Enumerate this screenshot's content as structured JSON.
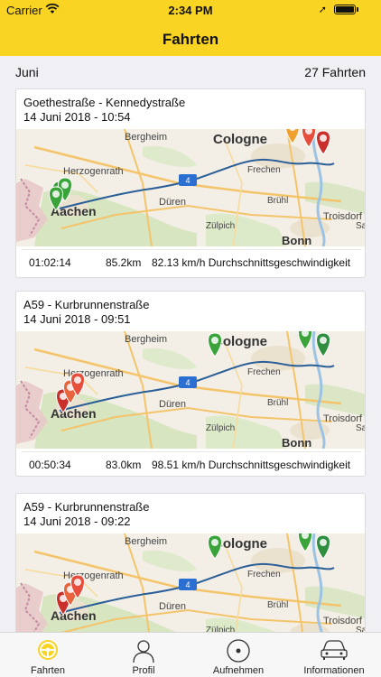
{
  "status_bar": {
    "carrier": "Carrier",
    "time": "2:34 PM"
  },
  "header": {
    "title": "Fahrten",
    "background": "#f9d423"
  },
  "subheader": {
    "month": "Juni",
    "count": "27 Fahrten"
  },
  "map_labels": {
    "bergheim": "Bergheim",
    "cologne": "Cologne",
    "herzogenrath": "Herzogenrath",
    "frechen": "Frechen",
    "dueren": "Düren",
    "aachen": "Aachen",
    "bruehl": "Brühl",
    "troisdorf": "Troisdorf",
    "zuelpich": "Zülpich",
    "bonn": "Bonn",
    "sa": "Sa",
    "motorway_shield": "4"
  },
  "trips": [
    {
      "route": "Goethestraße - Kennedystraße",
      "date": "14 Juni 2018 - 10:54",
      "duration": "01:02:14",
      "distance": "85.2km",
      "speed": "82.13 km/h Durchschnittsgeschwindigkeit"
    },
    {
      "route": "A59 - Kurbrunnenstraße",
      "date": "14 Juni 2018 - 09:51",
      "duration": "00:50:34",
      "distance": "83.0km",
      "speed": "98.51 km/h Durchschnittsgeschwindigkeit"
    },
    {
      "route": "A59 - Kurbrunnenstraße",
      "date": "14 Juni 2018 - 09:22",
      "duration": "",
      "distance": "",
      "speed": ""
    }
  ],
  "tabs": [
    {
      "label": "Fahrten",
      "icon": "steering-wheel-icon",
      "active": true
    },
    {
      "label": "Profil",
      "icon": "person-icon",
      "active": false
    },
    {
      "label": "Aufnehmen",
      "icon": "record-icon",
      "active": false
    },
    {
      "label": "Informationen",
      "icon": "car-icon",
      "active": false
    }
  ],
  "colors": {
    "accent": "#f9d423",
    "route": "#2a5e96",
    "pin_green": "#3aa33a",
    "pin_red": "#c9302c",
    "pin_orange": "#f0a030"
  }
}
